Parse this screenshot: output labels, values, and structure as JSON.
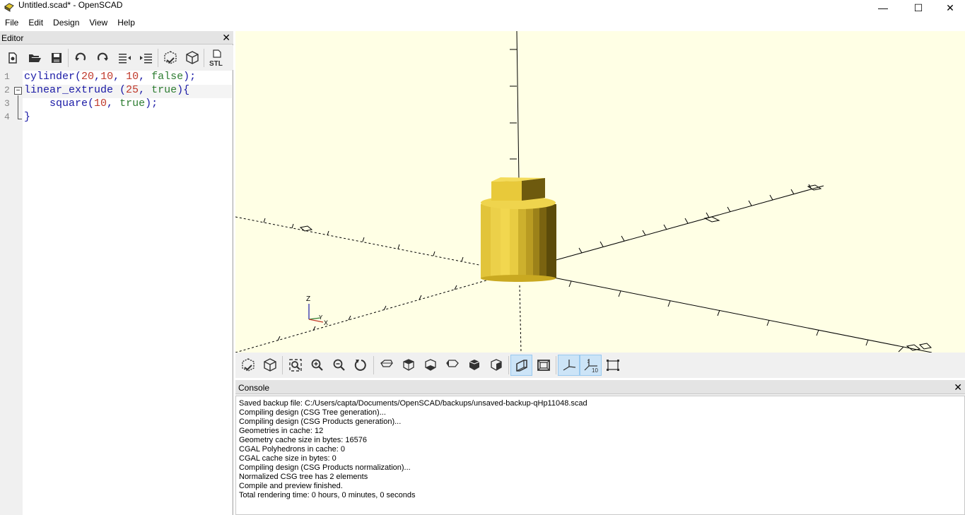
{
  "window": {
    "title": "Untitled.scad* - OpenSCAD",
    "minimize": "—",
    "maximize": "☐",
    "close": "✕"
  },
  "menu": [
    "File",
    "Edit",
    "Design",
    "View",
    "Help"
  ],
  "editor": {
    "title": "Editor",
    "close": "✕",
    "toolbar": [
      "new-file-icon",
      "open-file-icon",
      "save-icon",
      "undo-icon",
      "redo-icon",
      "unindent-icon",
      "indent-icon",
      "preview-icon",
      "render-icon",
      "export-stl-icon"
    ],
    "line_numbers": [
      "1",
      "2",
      "3",
      "4"
    ],
    "lines": [
      [
        {
          "t": "cylinder",
          "c": "kw"
        },
        {
          "t": "(",
          "c": "pun"
        },
        {
          "t": "20",
          "c": "num"
        },
        {
          "t": ",",
          "c": "pun"
        },
        {
          "t": "10",
          "c": "num"
        },
        {
          "t": ", ",
          "c": "pun"
        },
        {
          "t": "10",
          "c": "num"
        },
        {
          "t": ", ",
          "c": "pun"
        },
        {
          "t": "false",
          "c": "bool"
        },
        {
          "t": ");",
          "c": "pun"
        }
      ],
      [
        {
          "t": "linear_extrude ",
          "c": "kw"
        },
        {
          "t": "(",
          "c": "pun"
        },
        {
          "t": "25",
          "c": "num"
        },
        {
          "t": ", ",
          "c": "pun"
        },
        {
          "t": "true",
          "c": "bool"
        },
        {
          "t": "){",
          "c": "pun"
        }
      ],
      [
        {
          "t": "    square",
          "c": "kw"
        },
        {
          "t": "(",
          "c": "pun"
        },
        {
          "t": "10",
          "c": "num"
        },
        {
          "t": ", ",
          "c": "pun"
        },
        {
          "t": "true",
          "c": "bool"
        },
        {
          "t": ");",
          "c": "pun"
        }
      ],
      [
        {
          "t": "}",
          "c": "pun"
        }
      ]
    ]
  },
  "viewport": {
    "background": "#ffffe5",
    "object_color": "#f2d233",
    "axis_labels": {
      "z": "Z",
      "y": "Y",
      "x": "X"
    },
    "scale_label": "10"
  },
  "view_toolbar": [
    {
      "icon": "preview-icon",
      "active": false
    },
    {
      "icon": "render-icon",
      "active": false
    },
    {
      "sep": true
    },
    {
      "icon": "view-all-icon",
      "active": false
    },
    {
      "icon": "zoom-in-icon",
      "active": false
    },
    {
      "icon": "zoom-out-icon",
      "active": false
    },
    {
      "icon": "reset-view-icon",
      "active": false
    },
    {
      "sep": true
    },
    {
      "icon": "view-right-icon",
      "active": false
    },
    {
      "icon": "view-top-icon",
      "active": false
    },
    {
      "icon": "view-bottom-icon",
      "active": false
    },
    {
      "icon": "view-left-icon",
      "active": false
    },
    {
      "icon": "view-front-icon",
      "active": false
    },
    {
      "icon": "view-back-icon",
      "active": false
    },
    {
      "sep": true
    },
    {
      "icon": "perspective-icon",
      "active": true
    },
    {
      "icon": "orthogonal-icon",
      "active": false
    },
    {
      "sep": true
    },
    {
      "icon": "show-axes-icon",
      "active": true
    },
    {
      "icon": "show-scale-markers-icon",
      "active": true
    },
    {
      "icon": "show-edges-icon",
      "active": false
    }
  ],
  "console": {
    "title": "Console",
    "close": "✕",
    "lines": [
      "Saved backup file: C:/Users/capta/Documents/OpenSCAD/backups/unsaved-backup-qHp11048.scad",
      "Compiling design (CSG Tree generation)...",
      "Compiling design (CSG Products generation)...",
      "Geometries in cache: 12",
      "Geometry cache size in bytes: 16576",
      "CGAL Polyhedrons in cache: 0",
      "CGAL cache size in bytes: 0",
      "Compiling design (CSG Products normalization)...",
      "Normalized CSG tree has 2 elements",
      "Compile and preview finished.",
      "Total rendering time: 0 hours, 0 minutes, 0 seconds"
    ]
  }
}
